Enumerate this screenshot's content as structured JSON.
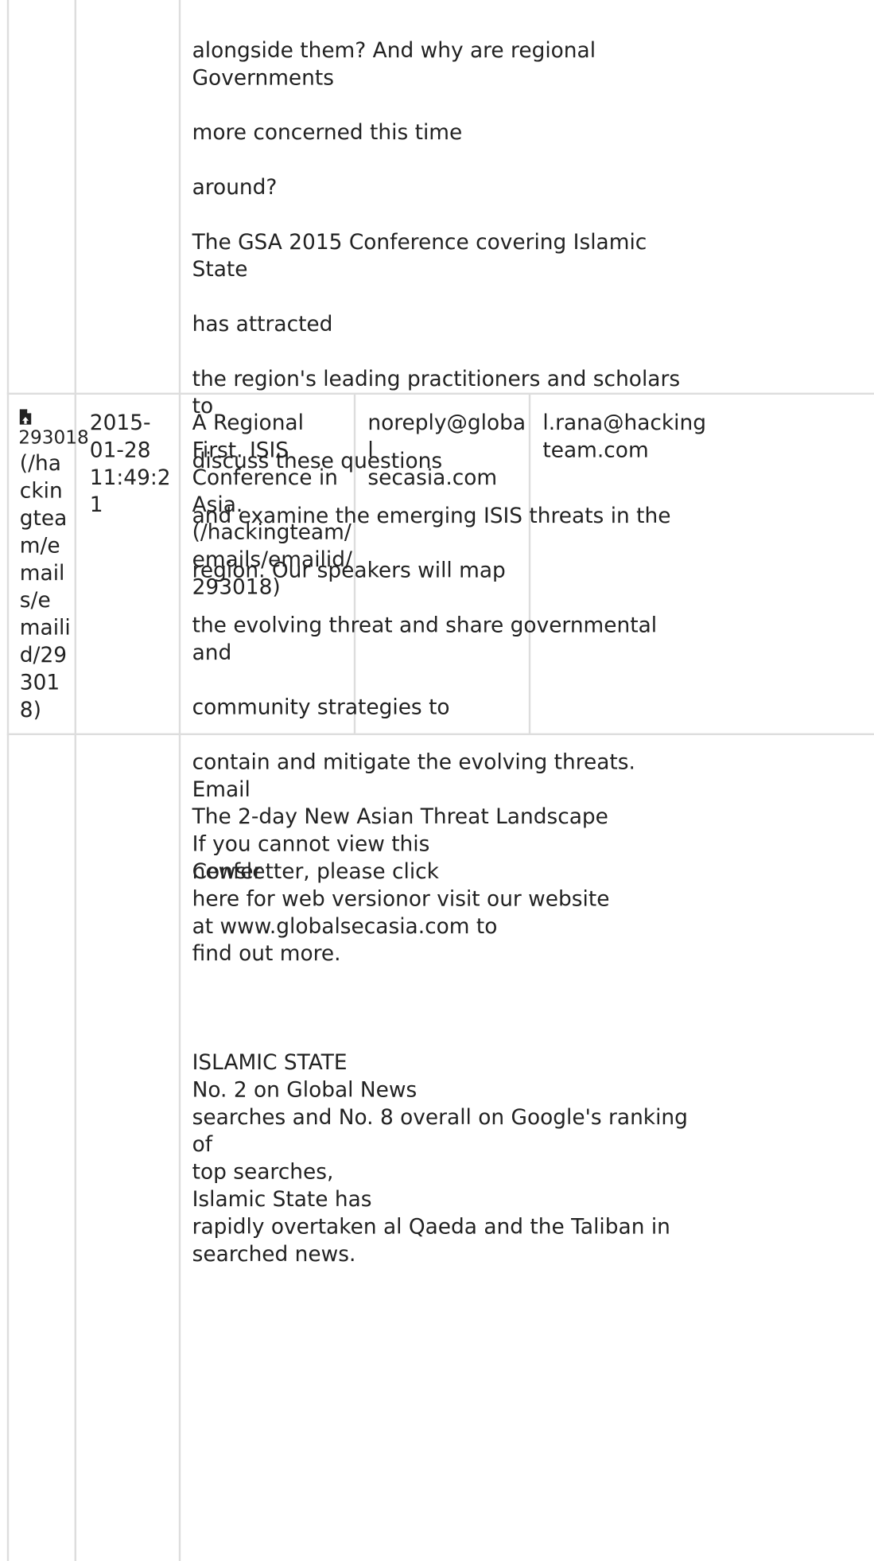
{
  "top_cell": {
    "lines": [
      "alongside them? And why are regional Governments",
      "more concerned this time",
      "around?",
      "The GSA 2015 Conference covering Islamic State",
      "has attracted",
      "the region's leading practitioners and scholars to",
      "discuss these questions",
      "and examine the emerging ISIS threats in the",
      "region. Our speakers will map",
      "the evolving threat and share governmental and",
      "community strategies to",
      "contain and mitigate the evolving threats.",
      "The 2-day New Asian Threat Landscape",
      "Confer"
    ]
  },
  "email_row": {
    "attachment_icon": "file-upload-icon",
    "id_label": "293018",
    "id_link_text": "(/ha\nckin\ngtea\nm/e\nmail\ns/e\nmaili\nd/29\n301\n8)",
    "date": "2015-\n01-28\n11:49:2\n1",
    "subject": "A Regional\nFirst. ISIS\nConference in\nAsia.\n(/hackingteam/\nemails/emailid/\n293018)",
    "from": "noreply@global\nsecasia.com",
    "to": "l.rana@hacking\nteam.com"
  },
  "body_cell": {
    "heading": "Email",
    "notice": "If you cannot view this\nnewsletter, please click\nhere for web versionor visit our website\nat www.globalsecasia.com to\nfind out more.",
    "section_title": "ISLAMIC STATE",
    "section_text": "No. 2 on Global News\nsearches and No. 8 overall on Google's ranking of\ntop searches,\nIslamic State has\nrapidly overtaken al Qaeda and the Taliban in\nsearched news."
  },
  "colors": {
    "border": "#dddddd",
    "text": "#222222",
    "background": "#ffffff"
  }
}
